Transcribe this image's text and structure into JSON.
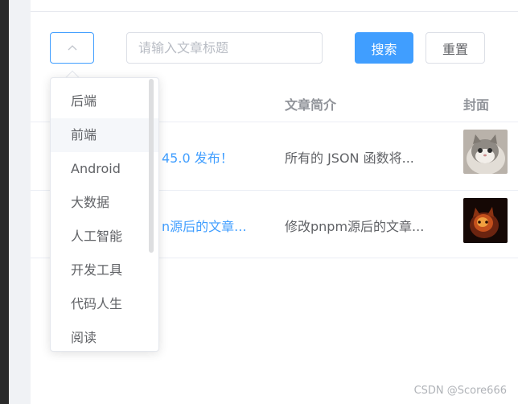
{
  "filter": {
    "category_select_value": "",
    "search_placeholder": "请输入文章标题",
    "search_button": "搜索",
    "reset_button": "重置"
  },
  "table": {
    "columns": [
      "文章简介",
      "封面"
    ],
    "rows": [
      {
        "title": "45.0 发布！",
        "intro": "所有的 JSON 函数将...",
        "cover_icon": "cat-photo"
      },
      {
        "title": "n源后的文章...",
        "intro": "修改pnpm源后的文章...",
        "cover_icon": "fire-cat-photo"
      }
    ]
  },
  "dropdown": {
    "items": [
      "后端",
      "前端",
      "Android",
      "大数据",
      "人工智能",
      "开发工具",
      "代码人生",
      "阅读"
    ],
    "hovered_index": 1
  },
  "watermark": "CSDN @Score666",
  "colors": {
    "primary": "#409eff",
    "border": "#dcdfe6",
    "text": "#606266",
    "header": "#909399"
  }
}
